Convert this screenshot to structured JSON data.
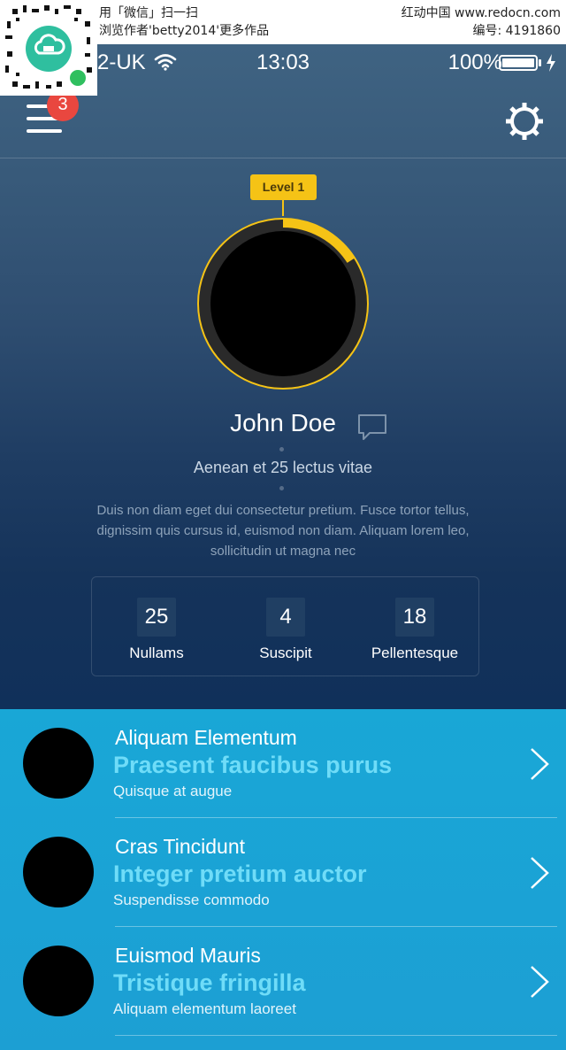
{
  "watermark": {
    "left_line1": "用「微信」扫一扫",
    "left_line2": "浏览作者'betty2014'更多作品",
    "right_line1": "红动中国 www.redocn.com",
    "right_line2": "编号: 4191860"
  },
  "status_bar": {
    "carrier": "2-UK",
    "time": "13:03",
    "battery": "100%"
  },
  "header": {
    "notification_count": "3"
  },
  "profile": {
    "level": "Level 1",
    "level_progress": 0.16,
    "name": "John Doe",
    "subtitle": "Aenean et 25 lectus vitae",
    "description": "Duis non diam eget dui consectetur pretium. Fusce tortor tellus, dignissim quis cursus id, euismod non diam. Aliquam lorem leo, sollicitudin ut magna nec"
  },
  "stats": [
    {
      "value": "25",
      "label": "Nullams"
    },
    {
      "value": "4",
      "label": "Suscipit"
    },
    {
      "value": "18",
      "label": "Pellentesque"
    }
  ],
  "list": [
    {
      "title": "Aliquam Elementum",
      "headline": "Praesent faucibus purus",
      "caption": "Quisque at augue"
    },
    {
      "title": "Cras Tincidunt",
      "headline": "Integer pretium auctor",
      "caption": "Suspendisse commodo"
    },
    {
      "title": "Euismod Mauris",
      "headline": "Tristique fringilla",
      "caption": "Aliquam elementum laoreet"
    }
  ],
  "colors": {
    "accent": "#f5c316",
    "badge": "#e9473f",
    "list_background": "#1aa5d6",
    "headline": "#6fdcf8"
  }
}
